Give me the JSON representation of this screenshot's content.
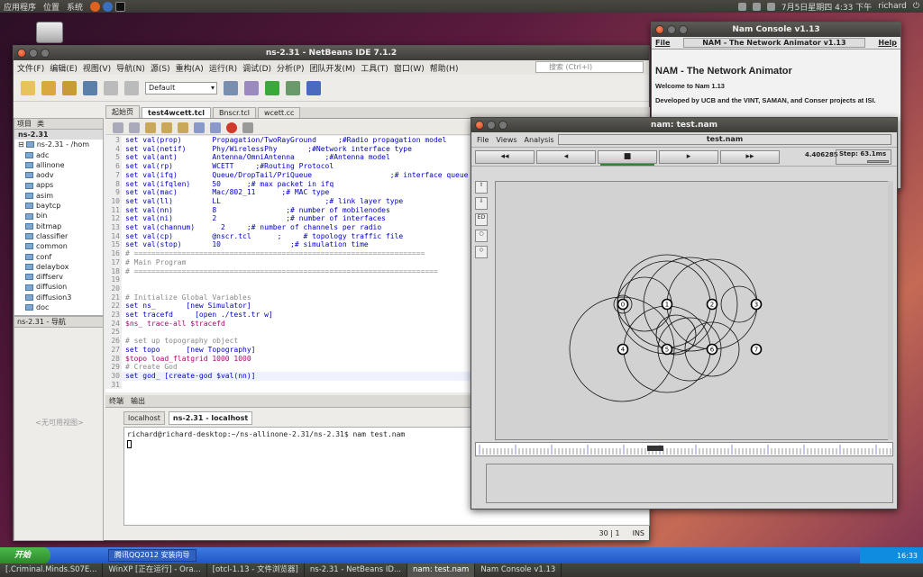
{
  "top_panel": {
    "menus": [
      "应用程序",
      "位置",
      "系统"
    ],
    "clock": "7月5日星期四  4:33 下午",
    "user": "richard"
  },
  "netbeans": {
    "title": "ns-2.31 - NetBeans IDE 7.1.2",
    "menu": [
      "文件(F)",
      "编辑(E)",
      "视图(V)",
      "导航(N)",
      "源(S)",
      "重构(A)",
      "运行(R)",
      "调试(D)",
      "分析(P)",
      "团队开发(M)",
      "工具(T)",
      "窗口(W)",
      "帮助(H)"
    ],
    "search_placeholder": "搜索 (Ctrl+I)",
    "config": "Default",
    "project_tabs": [
      "项目",
      "类"
    ],
    "project_root": "ns-2.31",
    "project_node": "ns-2.31 - /hom",
    "folders": [
      "adc",
      "allinone",
      "aodv",
      "apps",
      "asim",
      "baytcp",
      "bin",
      "bitmap",
      "classifier",
      "common",
      "conf",
      "delaybox",
      "diffserv",
      "diffusion",
      "diffusion3",
      "doc"
    ],
    "navigator_title": "ns-2.31 - 导航",
    "no_view": "<无可用视图>",
    "editor_tabs": [
      "起始页",
      "test4wcett.tcl",
      "Bnscr.tcl",
      "wcett.cc"
    ],
    "terminal_tabs": [
      "终端",
      "输出"
    ],
    "terminal_subtabs": [
      "localhost",
      "ns-2.31 - localhost"
    ],
    "terminal_line": "richard@richard-desktop:~/ns-allinone-2.31/ns-2.31$ nam test.nam",
    "status_pos": "30 | 1",
    "status_mode": "INS",
    "code": [
      [
        "3",
        "set val(prop)       Propagation/TwoRayGround     ;#Radio propagation model"
      ],
      [
        "4",
        "set val(netif)      Phy/WirelessPhy       ;#Network interface type"
      ],
      [
        "5",
        "set val(ant)        Antenna/OmniAntenna       ;#Antenna model"
      ],
      [
        "6",
        "set val(rp)         WCETT     ;#Routing Protocol"
      ],
      [
        "7",
        "set val(ifq)        Queue/DropTail/PriQueue                  ;# interface queue"
      ],
      [
        "8",
        "set val(ifqlen)     50      ;# max packet in ifq"
      ],
      [
        "9",
        "set val(mac)        Mac/802_11      ;# MAC type"
      ],
      [
        "10",
        "set val(ll)         LL                        ;# link layer type"
      ],
      [
        "11",
        "set val(nn)         8                ;# number of mobilenodes"
      ],
      [
        "12",
        "set val(ni)         2                ;# number of interfaces"
      ],
      [
        "13",
        "set val(channum)      2     ;# number of channels per radio"
      ],
      [
        "14",
        "set val(cp)         @nscr.tcl      ;     # topology traffic file"
      ],
      [
        "15",
        "set val(stop)       10                ;# simulation time"
      ],
      [
        "16",
        "# ==================================================================="
      ],
      [
        "17",
        "# Main Program"
      ],
      [
        "18",
        "# ======================================================================"
      ],
      [
        "19",
        ""
      ],
      [
        "20",
        ""
      ],
      [
        "21",
        "# Initialize Global Variables"
      ],
      [
        "22",
        "set ns_       [new Simulator]"
      ],
      [
        "23",
        "set tracefd     [open ./test.tr w]"
      ],
      [
        "24",
        "$ns_ trace-all $tracefd"
      ],
      [
        "25",
        ""
      ],
      [
        "26",
        "# set up topography object"
      ],
      [
        "27",
        "set topo      [new Topography]"
      ],
      [
        "28",
        "$topo load_flatgrid 1000 1000"
      ],
      [
        "29",
        "# Create God"
      ],
      [
        "30",
        "set god_ [create-god $val(nn)]"
      ],
      [
        "31",
        ""
      ]
    ]
  },
  "console": {
    "title": "Nam Console v1.13",
    "file": "File",
    "center": "NAM - The Network Animator v1.13",
    "help": "Help",
    "heading": "NAM - The Network Animator",
    "welcome": "Welcome to Nam 1.13",
    "dev": "Developed by UCB and the VINT, SAMAN, and Conser projects at ISI."
  },
  "nam": {
    "title": "nam: test.nam",
    "menu": [
      "File",
      "Views",
      "Analysis"
    ],
    "file": "test.nam",
    "time": "4.406285",
    "step": "Step: 63.1ms",
    "buttons": [
      "◂◂",
      "◂",
      "■",
      "▸",
      "▸▸"
    ],
    "nodes": [
      {
        "id": "0"
      },
      {
        "id": "1"
      },
      {
        "id": "2"
      },
      {
        "id": "3"
      },
      {
        "id": "4"
      },
      {
        "id": "5"
      },
      {
        "id": "6"
      },
      {
        "id": "7"
      }
    ]
  },
  "taskbar": {
    "start": "开始",
    "qq": "腾讯QQ2012  安装向导",
    "time": "16:33",
    "tasks": [
      "[.Criminal.Minds.S07E...",
      "WinXP [正在运行] - Ora...",
      "[otcl-1.13 - 文件浏览器]",
      "ns-2.31 - NetBeans ID...",
      "nam: test.nam",
      "Nam Console v1.13"
    ]
  }
}
